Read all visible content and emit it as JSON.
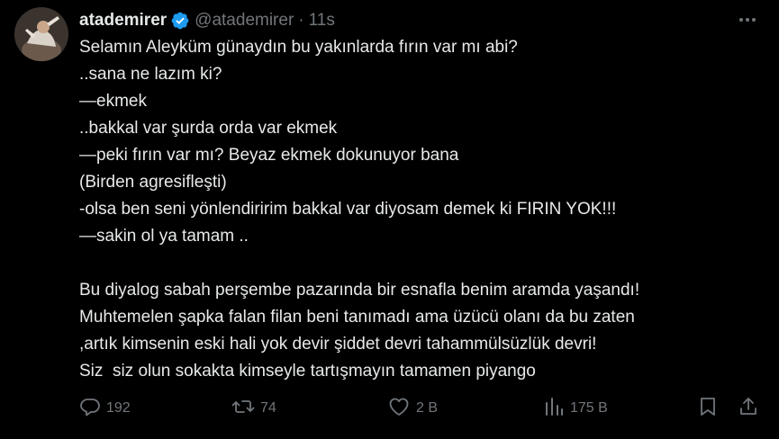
{
  "author": {
    "display_name": "atademirer",
    "handle": "@atademirer",
    "separator": "·",
    "time": "11s",
    "verified": true
  },
  "tweet": {
    "lines": [
      "Selamın Aleyküm günaydın bu yakınlarda fırın var mı abi?",
      "..sana ne lazım ki?",
      "—ekmek",
      "..bakkal var şurda orda var ekmek",
      "—peki fırın var mı? Beyaz ekmek dokunuyor bana",
      "(Birden agresifleşti)",
      "-olsa ben seni yönlendiririm bakkal var diyosam demek ki FIRIN YOK!!!",
      "—sakin ol ya tamam ..",
      "",
      "Bu diyalog sabah perşembe pazarında bir esnafla benim aramda yaşandı!",
      "Muhtemelen şapka falan filan beni tanımadı ama üzücü olanı da bu zaten",
      ",artık kimsenin eski hali yok devir şiddet devri tahammülsüzlük devri!",
      "Siz  siz olun sokakta kimseyle tartışmayın tamamen piyango"
    ]
  },
  "actions": {
    "replies": "192",
    "retweets": "74",
    "likes": "2 B",
    "views": "175 B"
  },
  "icons": {
    "more": "more-icon",
    "verified": "verified-badge-icon",
    "reply": "reply-icon",
    "retweet": "retweet-icon",
    "like": "heart-icon",
    "views": "views-icon",
    "bookmark": "bookmark-icon",
    "share": "share-icon"
  },
  "colors": {
    "background": "#000000",
    "text": "#e7e9ea",
    "muted": "#71767b",
    "verified": "#1d9bf0"
  }
}
